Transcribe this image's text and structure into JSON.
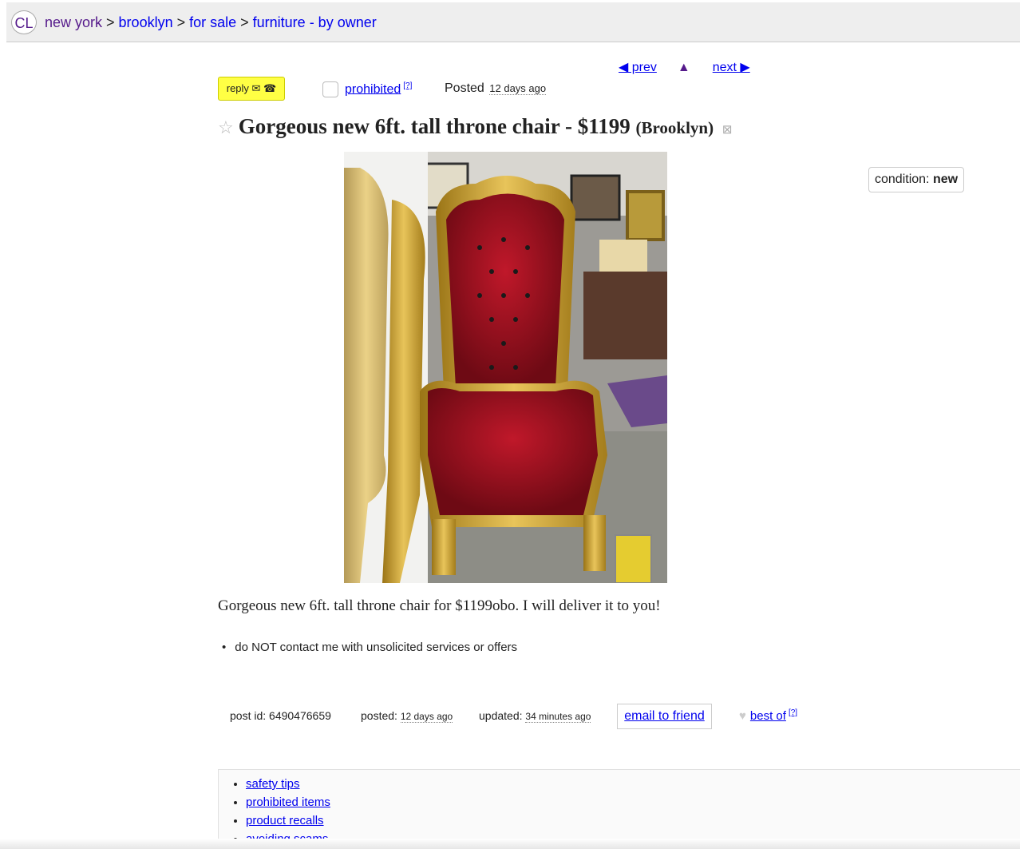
{
  "header": {
    "logo": "CL",
    "breadcrumbs": [
      "new york",
      "brooklyn",
      "for sale",
      "furniture - by owner"
    ],
    "separator": ">"
  },
  "nav": {
    "prev": "◀ prev",
    "up": "▲",
    "next": "next ▶"
  },
  "actions": {
    "reply": "reply ✉ ☎",
    "prohibited": "prohibited",
    "help_mark": "[?]",
    "posted_label": "Posted",
    "posted_date": "12 days ago"
  },
  "listing": {
    "star": "☆",
    "title": "Gorgeous new 6ft. tall throne chair - $1199",
    "location": "(Brooklyn)",
    "hide_icon": "⊠",
    "condition_label": "condition:",
    "condition_value": "new",
    "body": "Gorgeous new 6ft. tall throne chair for $1199obo. I will deliver it to you!",
    "notices": [
      "do NOT contact me with unsolicited services or offers"
    ]
  },
  "postinfo": {
    "id_label": "post id: 6490476659",
    "posted_label": "posted:",
    "posted_value": "12 days ago",
    "updated_label": "updated:",
    "updated_value": "34 minutes ago",
    "email_friend": "email to friend",
    "best_of": "best of",
    "best_of_help": "[?]",
    "heart_icon": "♥"
  },
  "footer": {
    "links": [
      "safety tips",
      "prohibited items",
      "product recalls",
      "avoiding scams"
    ]
  },
  "colors": {
    "link": "#0000ee",
    "visited": "#551a8b",
    "reply_bg": "#ffff44",
    "topbar_bg": "#eeeeee"
  }
}
